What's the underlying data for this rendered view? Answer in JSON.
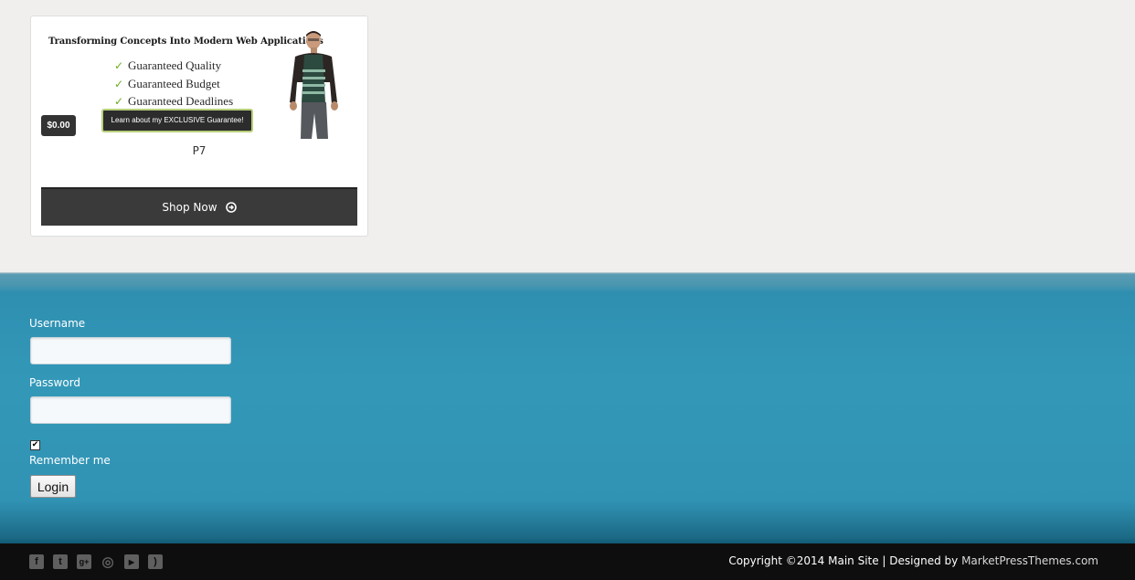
{
  "product": {
    "banner_headline": "Transforming Concepts Into Modern Web Applications",
    "banner_points": [
      "Guaranteed Quality",
      "Guaranteed Budget",
      "Guaranteed Deadlines"
    ],
    "banner_button": "Learn about my EXCLUSIVE Guarantee!",
    "price": "$0.00",
    "title": "P7",
    "shop_button": "Shop Now",
    "shop_icon": "arrow-circle-right-icon",
    "check_icon": "check-icon"
  },
  "login": {
    "username_label": "Username",
    "password_label": "Password",
    "remember_label": "Remember me",
    "remember_checked": true,
    "login_button": "Login"
  },
  "footer": {
    "social_icons": [
      "facebook-icon",
      "twitter-icon",
      "google-plus-icon",
      "dribbble-icon",
      "youtube-icon",
      "rss-icon"
    ],
    "social_glyphs": [
      "f",
      "t",
      "g+",
      "◎",
      "▶",
      ")"
    ],
    "copyright_text": "Copyright ©2014 Main Site | Designed by ",
    "designer_link": "MarketPressThemes.com"
  },
  "colors": {
    "login_background": "#3398b8",
    "footer_background": "#0e0e0e",
    "shop_button": "#3a3a3a",
    "check_green": "#6aab1c"
  }
}
